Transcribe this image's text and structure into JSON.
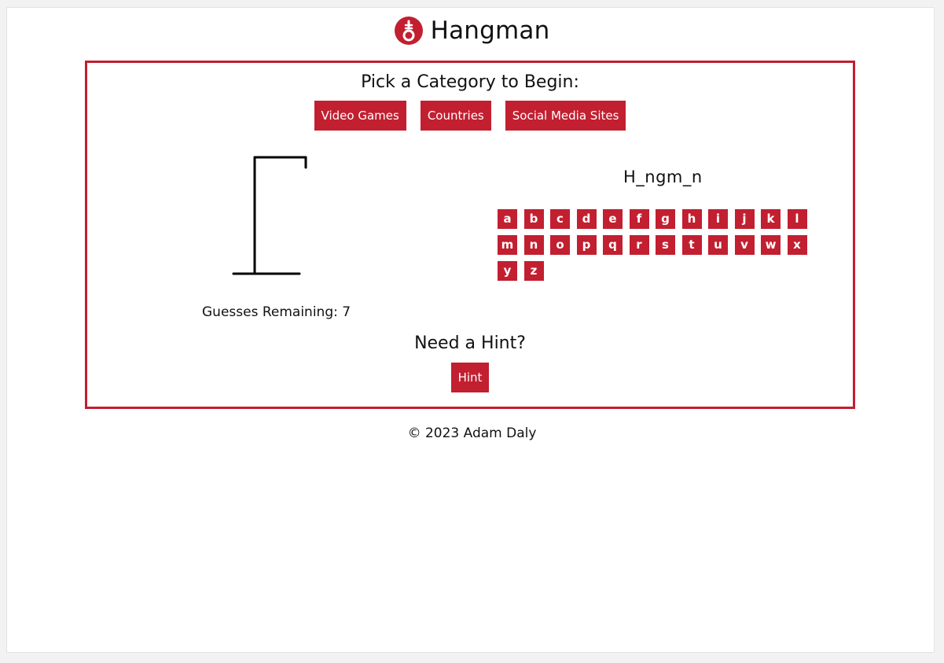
{
  "header": {
    "title": "Hangman",
    "logo_icon": "noose-icon"
  },
  "category": {
    "heading": "Pick a Category to Begin:",
    "buttons": [
      "Video Games",
      "Countries",
      "Social Media Sites"
    ]
  },
  "game": {
    "guesses_label": "Guesses Remaining: 7",
    "word_display": "H_ngm_n",
    "letters": [
      "a",
      "b",
      "c",
      "d",
      "e",
      "f",
      "g",
      "h",
      "i",
      "j",
      "k",
      "l",
      "m",
      "n",
      "o",
      "p",
      "q",
      "r",
      "s",
      "t",
      "u",
      "v",
      "w",
      "x",
      "y",
      "z"
    ]
  },
  "hint": {
    "heading": "Need a Hint?",
    "button_label": "Hint"
  },
  "footer": {
    "text": "© 2023 Adam Daly"
  },
  "colors": {
    "accent": "#c21f30",
    "background": "#ffffff",
    "text": "#111111"
  }
}
